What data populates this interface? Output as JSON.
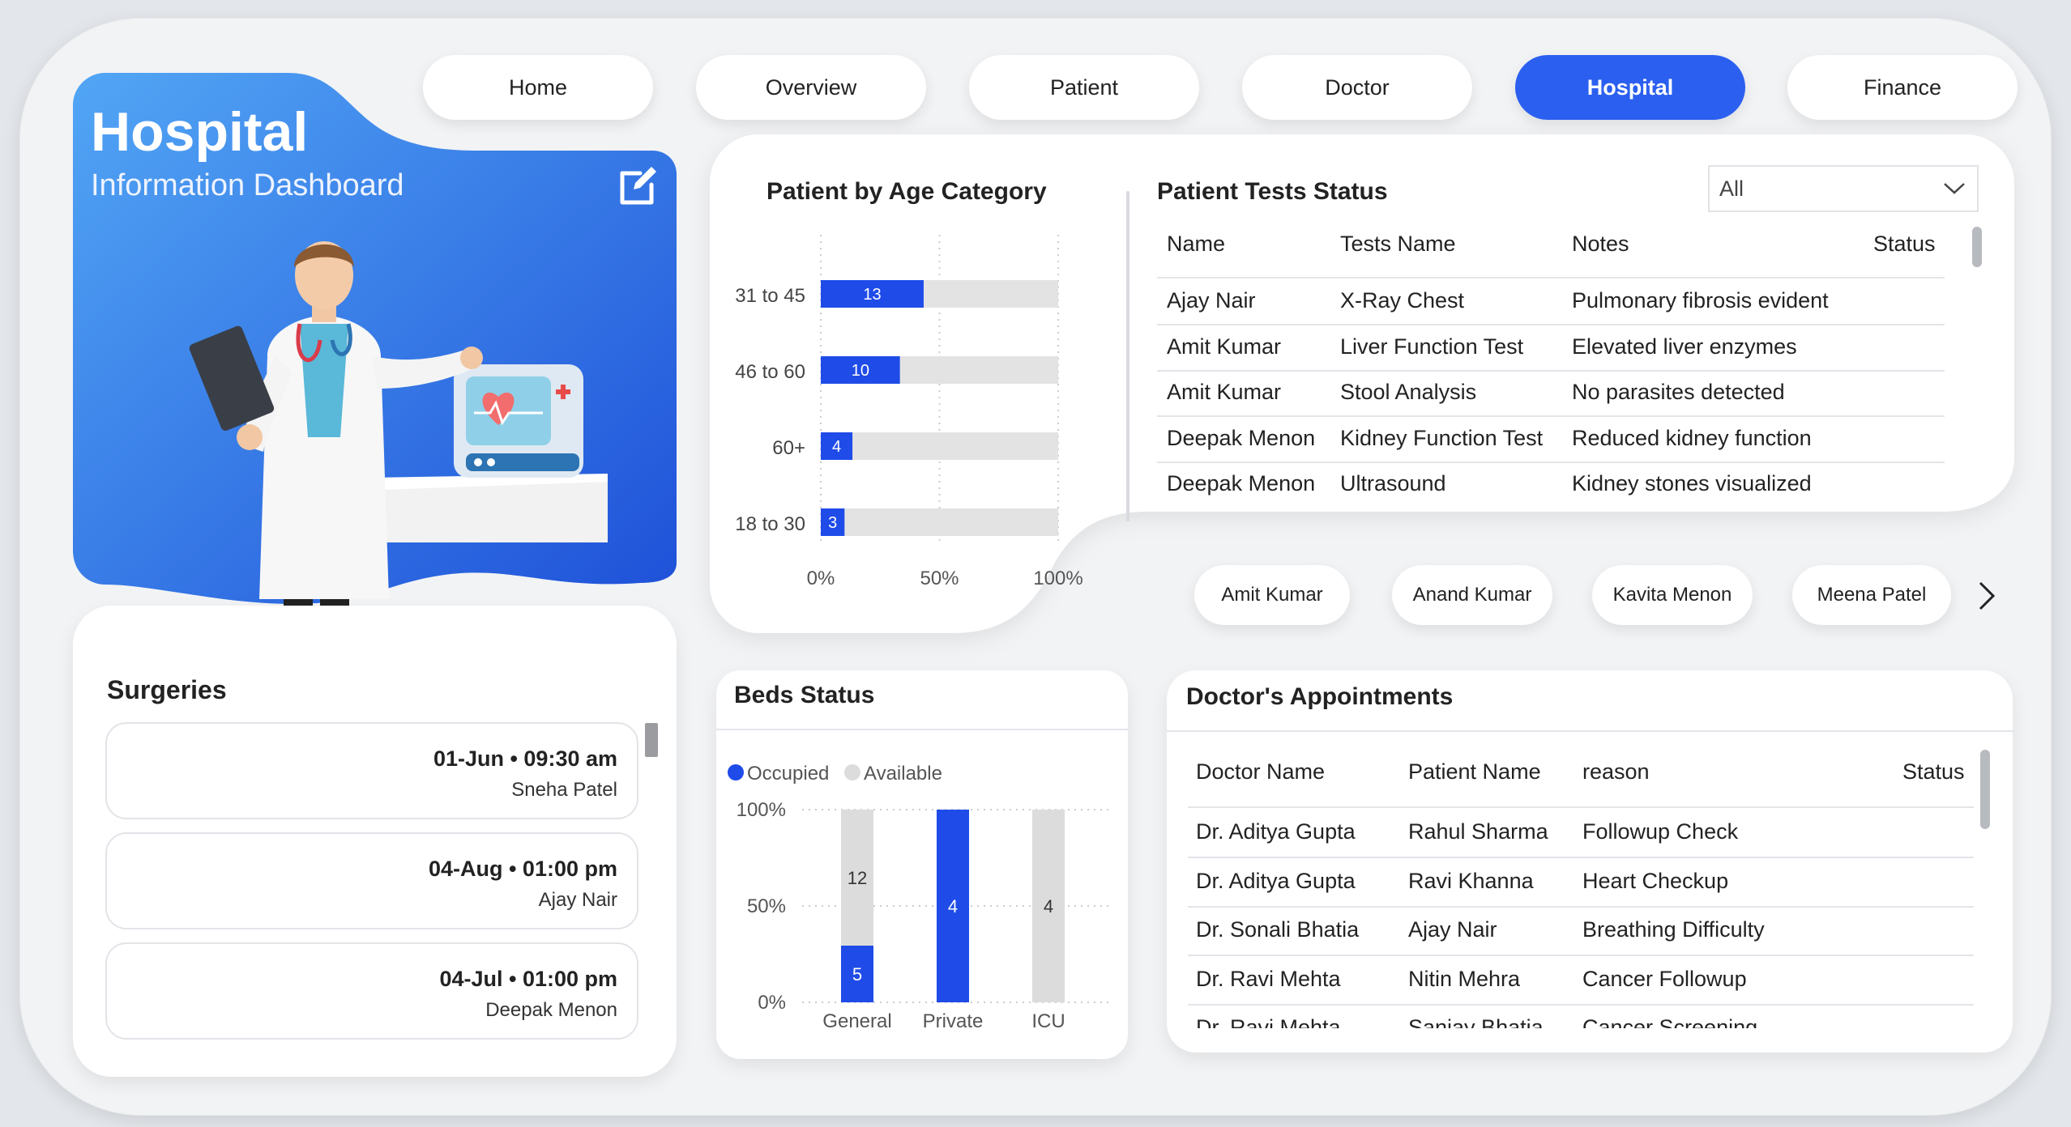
{
  "nav": [
    "Home",
    "Overview",
    "Patient",
    "Doctor",
    "Hospital",
    "Finance"
  ],
  "nav_active": "Hospital",
  "hero": {
    "title": "Hospital",
    "subtitle": "Information Dashboard"
  },
  "surgeries": {
    "title": "Surgeries",
    "items": [
      {
        "date": "01-Jun • 09:30 am",
        "patient": "Sneha Patel"
      },
      {
        "date": "04-Aug • 01:00 pm",
        "patient": "Ajay Nair"
      },
      {
        "date": "04-Jul • 01:00 pm",
        "patient": "Deepak Menon"
      }
    ]
  },
  "age_chart": {
    "title": "Patient by Age Category",
    "x_ticks": [
      "0%",
      "50%",
      "100%"
    ]
  },
  "tests": {
    "title": "Patient Tests Status",
    "filter_value": "All",
    "columns": [
      "Name",
      "Tests Name",
      "Notes",
      "Status"
    ],
    "rows": [
      {
        "name": "Ajay Nair",
        "test": "X-Ray Chest",
        "notes": "Pulmonary fibrosis evident"
      },
      {
        "name": "Amit Kumar",
        "test": "Liver Function Test",
        "notes": "Elevated liver enzymes"
      },
      {
        "name": "Amit Kumar",
        "test": "Stool Analysis",
        "notes": "No parasites detected"
      },
      {
        "name": "Deepak Menon",
        "test": "Kidney Function Test",
        "notes": "Reduced kidney function"
      },
      {
        "name": "Deepak Menon",
        "test": "Ultrasound",
        "notes": "Kidney stones visualized"
      }
    ],
    "status_icon": "double-check-icon"
  },
  "doctor_chips": [
    "Amit Kumar",
    "Anand Kumar",
    "Kavita Menon",
    "Meena Patel"
  ],
  "beds": {
    "title": "Beds Status",
    "legend": [
      "Occupied",
      "Available"
    ],
    "y_ticks": [
      "100%",
      "50%",
      "0%"
    ]
  },
  "appointments": {
    "title": "Doctor's Appointments",
    "columns": [
      "Doctor Name",
      "Patient Name",
      "reason",
      "Status"
    ],
    "rows": [
      {
        "doctor": "Dr. Aditya Gupta",
        "patient": "Rahul Sharma",
        "reason": "Followup Check",
        "status_icon": "calendar-clock-icon"
      },
      {
        "doctor": "Dr. Aditya Gupta",
        "patient": "Ravi Khanna",
        "reason": "Heart Checkup",
        "status_icon": "calendar-clock-icon"
      },
      {
        "doctor": "Dr. Sonali Bhatia",
        "patient": "Ajay Nair",
        "reason": "Breathing Difficulty",
        "status_icon": "double-check-icon"
      },
      {
        "doctor": "Dr. Ravi Mehta",
        "patient": "Nitin Mehra",
        "reason": "Cancer Followup",
        "status_icon": "double-check-icon"
      },
      {
        "doctor": "Dr. Ravi Mehta",
        "patient": "Sanjay Bhatia",
        "reason": "Cancer Screening",
        "status_icon": "double-check-icon"
      }
    ]
  },
  "colors": {
    "accent": "#2b5ff0",
    "bar_blue": "#1f4be8",
    "bar_grey": "#e3e3e3",
    "check_blue": "#3a78e0"
  },
  "chart_data": [
    {
      "type": "bar",
      "orientation": "horizontal",
      "title": "Patient by Age Category",
      "categories": [
        "31 to 45",
        "46 to 60",
        "60+",
        "18 to 30"
      ],
      "values": [
        13,
        10,
        4,
        3
      ],
      "value_scale_max": 30,
      "x_ticks": [
        "0%",
        "50%",
        "100%"
      ],
      "xlim": [
        0,
        100
      ],
      "grid": true
    },
    {
      "type": "bar",
      "stacked": true,
      "title": "Beds Status",
      "categories": [
        "General",
        "Private",
        "ICU"
      ],
      "series": [
        {
          "name": "Occupied",
          "values": [
            5,
            4,
            0
          ]
        },
        {
          "name": "Available",
          "values": [
            12,
            0,
            4
          ]
        }
      ],
      "ylim": [
        0,
        100
      ],
      "y_ticks": [
        "0%",
        "50%",
        "100%"
      ],
      "legend": "top-left"
    }
  ]
}
